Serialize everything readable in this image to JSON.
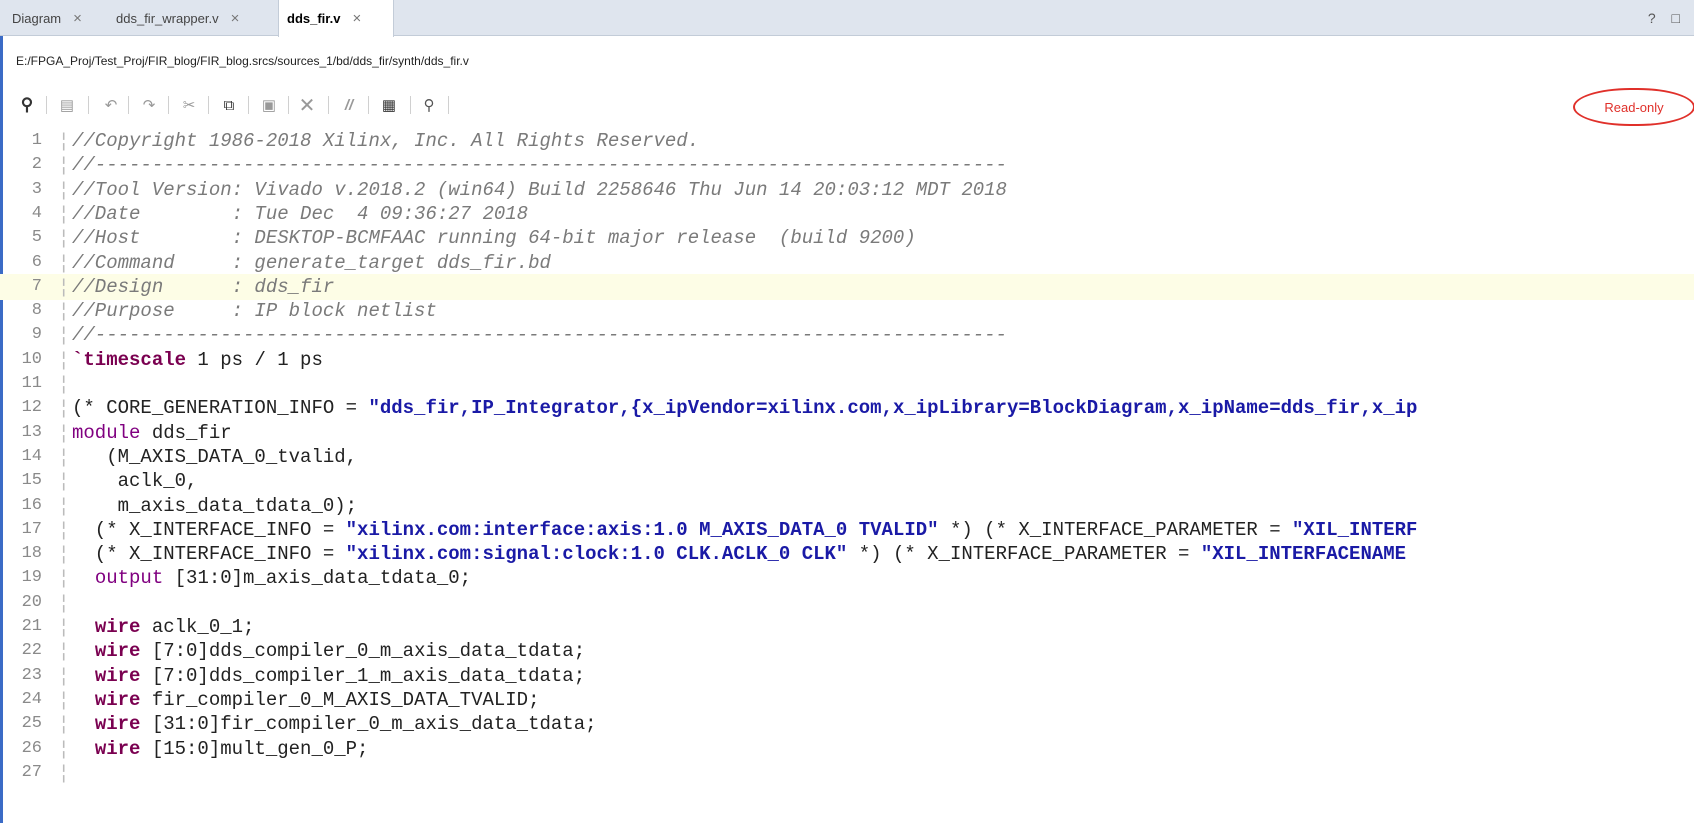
{
  "tabs": [
    {
      "label": "Diagram",
      "close": "×"
    },
    {
      "label": "dds_fir_wrapper.v",
      "close": "×"
    },
    {
      "label": "dds_fir.v",
      "close": "×"
    }
  ],
  "window_controls": "? □",
  "file_path": "E:/FPGA_Proj/Test_Proj/FIR_blog/FIR_blog.srcs/sources_1/bd/dds_fir/synth/dds_fir.v",
  "toolbar": {
    "icons": [
      "search-icon",
      "save-icon",
      "undo-icon",
      "redo-icon",
      "cut-icon",
      "copy-icon",
      "paste-icon",
      "delete-icon",
      "comment-icon",
      "column-select-icon",
      "hint-icon"
    ],
    "readonly_label": "Read-only"
  },
  "editor": {
    "highlighted_line": 7,
    "lines": [
      {
        "n": "1",
        "segs": [
          {
            "t": "cm",
            "v": "//Copyright 1986-2018 Xilinx, Inc. All Rights Reserved."
          }
        ]
      },
      {
        "n": "2",
        "segs": [
          {
            "t": "cm",
            "v": "//--------------------------------------------------------------------------------"
          }
        ]
      },
      {
        "n": "3",
        "segs": [
          {
            "t": "cm",
            "v": "//Tool Version: Vivado v.2018.2 (win64) Build 2258646 Thu Jun 14 20:03:12 MDT 2018"
          }
        ]
      },
      {
        "n": "4",
        "segs": [
          {
            "t": "cm",
            "v": "//Date        : Tue Dec  4 09:36:27 2018"
          }
        ]
      },
      {
        "n": "5",
        "segs": [
          {
            "t": "cm",
            "v": "//Host        : DESKTOP-BCMFAAC running 64-bit major release  (build 9200)"
          }
        ]
      },
      {
        "n": "6",
        "segs": [
          {
            "t": "cm",
            "v": "//Command     : generate_target dds_fir.bd"
          }
        ]
      },
      {
        "n": "7",
        "segs": [
          {
            "t": "cm",
            "v": "//Design      : dds_fir"
          }
        ]
      },
      {
        "n": "8",
        "segs": [
          {
            "t": "cm",
            "v": "//Purpose     : IP block netlist"
          }
        ]
      },
      {
        "n": "9",
        "segs": [
          {
            "t": "cm",
            "v": "//--------------------------------------------------------------------------------"
          }
        ]
      },
      {
        "n": "10",
        "segs": [
          {
            "t": "kw",
            "v": "`timescale"
          },
          {
            "t": "tx",
            "v": " 1 ps / 1 ps"
          }
        ]
      },
      {
        "n": "11",
        "segs": []
      },
      {
        "n": "12",
        "segs": [
          {
            "t": "tx",
            "v": "(* CORE_GENERATION_INFO = "
          },
          {
            "t": "st",
            "v": "\"dds_fir,IP_Integrator,{x_ipVendor=xilinx.com,x_ipLibrary=BlockDiagram,x_ipName=dds_fir,x_ip"
          }
        ]
      },
      {
        "n": "13",
        "segs": [
          {
            "t": "kw2",
            "v": "module"
          },
          {
            "t": "tx",
            "v": " dds_fir"
          }
        ]
      },
      {
        "n": "14",
        "segs": [
          {
            "t": "tx",
            "v": "   (M_AXIS_DATA_0_tvalid,"
          }
        ]
      },
      {
        "n": "15",
        "segs": [
          {
            "t": "tx",
            "v": "    aclk_0,"
          }
        ]
      },
      {
        "n": "16",
        "segs": [
          {
            "t": "tx",
            "v": "    m_axis_data_tdata_0);"
          }
        ]
      },
      {
        "n": "17",
        "segs": [
          {
            "t": "tx",
            "v": "  (* X_INTERFACE_INFO = "
          },
          {
            "t": "st",
            "v": "\"xilinx.com:interface:axis:1.0 M_AXIS_DATA_0 TVALID\""
          },
          {
            "t": "tx",
            "v": " *) (* X_INTERFACE_PARAMETER = "
          },
          {
            "t": "st",
            "v": "\"XIL_INTERF"
          }
        ]
      },
      {
        "n": "18",
        "segs": [
          {
            "t": "tx",
            "v": "  (* X_INTERFACE_INFO = "
          },
          {
            "t": "st",
            "v": "\"xilinx.com:signal:clock:1.0 CLK.ACLK_0 CLK\""
          },
          {
            "t": "tx",
            "v": " *) (* X_INTERFACE_PARAMETER = "
          },
          {
            "t": "st",
            "v": "\"XIL_INTERFACENAME"
          }
        ]
      },
      {
        "n": "19",
        "segs": [
          {
            "t": "tx",
            "v": "  "
          },
          {
            "t": "kw2",
            "v": "output"
          },
          {
            "t": "tx",
            "v": " [31:0]m_axis_data_tdata_0;"
          }
        ]
      },
      {
        "n": "20",
        "segs": []
      },
      {
        "n": "21",
        "segs": [
          {
            "t": "tx",
            "v": "  "
          },
          {
            "t": "kw",
            "v": "wire"
          },
          {
            "t": "tx",
            "v": " aclk_0_1;"
          }
        ]
      },
      {
        "n": "22",
        "segs": [
          {
            "t": "tx",
            "v": "  "
          },
          {
            "t": "kw",
            "v": "wire"
          },
          {
            "t": "tx",
            "v": " [7:0]dds_compiler_0_m_axis_data_tdata;"
          }
        ]
      },
      {
        "n": "23",
        "segs": [
          {
            "t": "tx",
            "v": "  "
          },
          {
            "t": "kw",
            "v": "wire"
          },
          {
            "t": "tx",
            "v": " [7:0]dds_compiler_1_m_axis_data_tdata;"
          }
        ]
      },
      {
        "n": "24",
        "segs": [
          {
            "t": "tx",
            "v": "  "
          },
          {
            "t": "kw",
            "v": "wire"
          },
          {
            "t": "tx",
            "v": " fir_compiler_0_M_AXIS_DATA_TVALID;"
          }
        ]
      },
      {
        "n": "25",
        "segs": [
          {
            "t": "tx",
            "v": "  "
          },
          {
            "t": "kw",
            "v": "wire"
          },
          {
            "t": "tx",
            "v": " [31:0]fir_compiler_0_m_axis_data_tdata;"
          }
        ]
      },
      {
        "n": "26",
        "segs": [
          {
            "t": "tx",
            "v": "  "
          },
          {
            "t": "kw",
            "v": "wire"
          },
          {
            "t": "tx",
            "v": " [15:0]mult_gen_0_P;"
          }
        ]
      },
      {
        "n": "27",
        "segs": []
      }
    ]
  }
}
